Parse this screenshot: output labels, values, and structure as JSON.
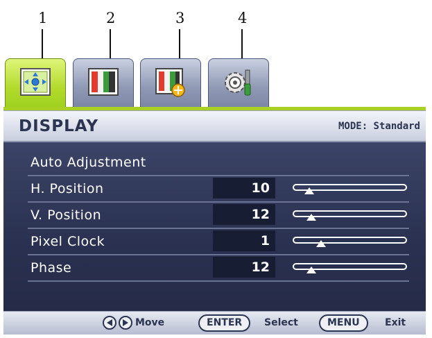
{
  "callouts": [
    "1",
    "2",
    "3",
    "4"
  ],
  "tabs": [
    {
      "icon": "display-icon",
      "active": true
    },
    {
      "icon": "picture-icon",
      "active": false
    },
    {
      "icon": "picture-advanced-icon",
      "active": false
    },
    {
      "icon": "system-settings-icon",
      "active": false
    }
  ],
  "header": {
    "title": "DISPLAY",
    "mode": "MODE: Standard"
  },
  "menu": {
    "items": [
      {
        "label": "Auto Adjustment"
      },
      {
        "label": "H. Position",
        "value": "10",
        "level": 0.1
      },
      {
        "label": "V. Position",
        "value": "12",
        "level": 0.12
      },
      {
        "label": "Pixel Clock",
        "value": "1",
        "level": 0.22
      },
      {
        "label": "Phase",
        "value": "12",
        "level": 0.12
      }
    ]
  },
  "footer": {
    "move": "Move",
    "enter_key": "ENTER",
    "select": "Select",
    "menu_key": "MENU",
    "exit": "Exit"
  },
  "colors": {
    "active_tab": "#b2da2b",
    "inactive_tab": "#8f99b4",
    "panel_body": "#2b3252",
    "header_text": "#2b3450"
  }
}
